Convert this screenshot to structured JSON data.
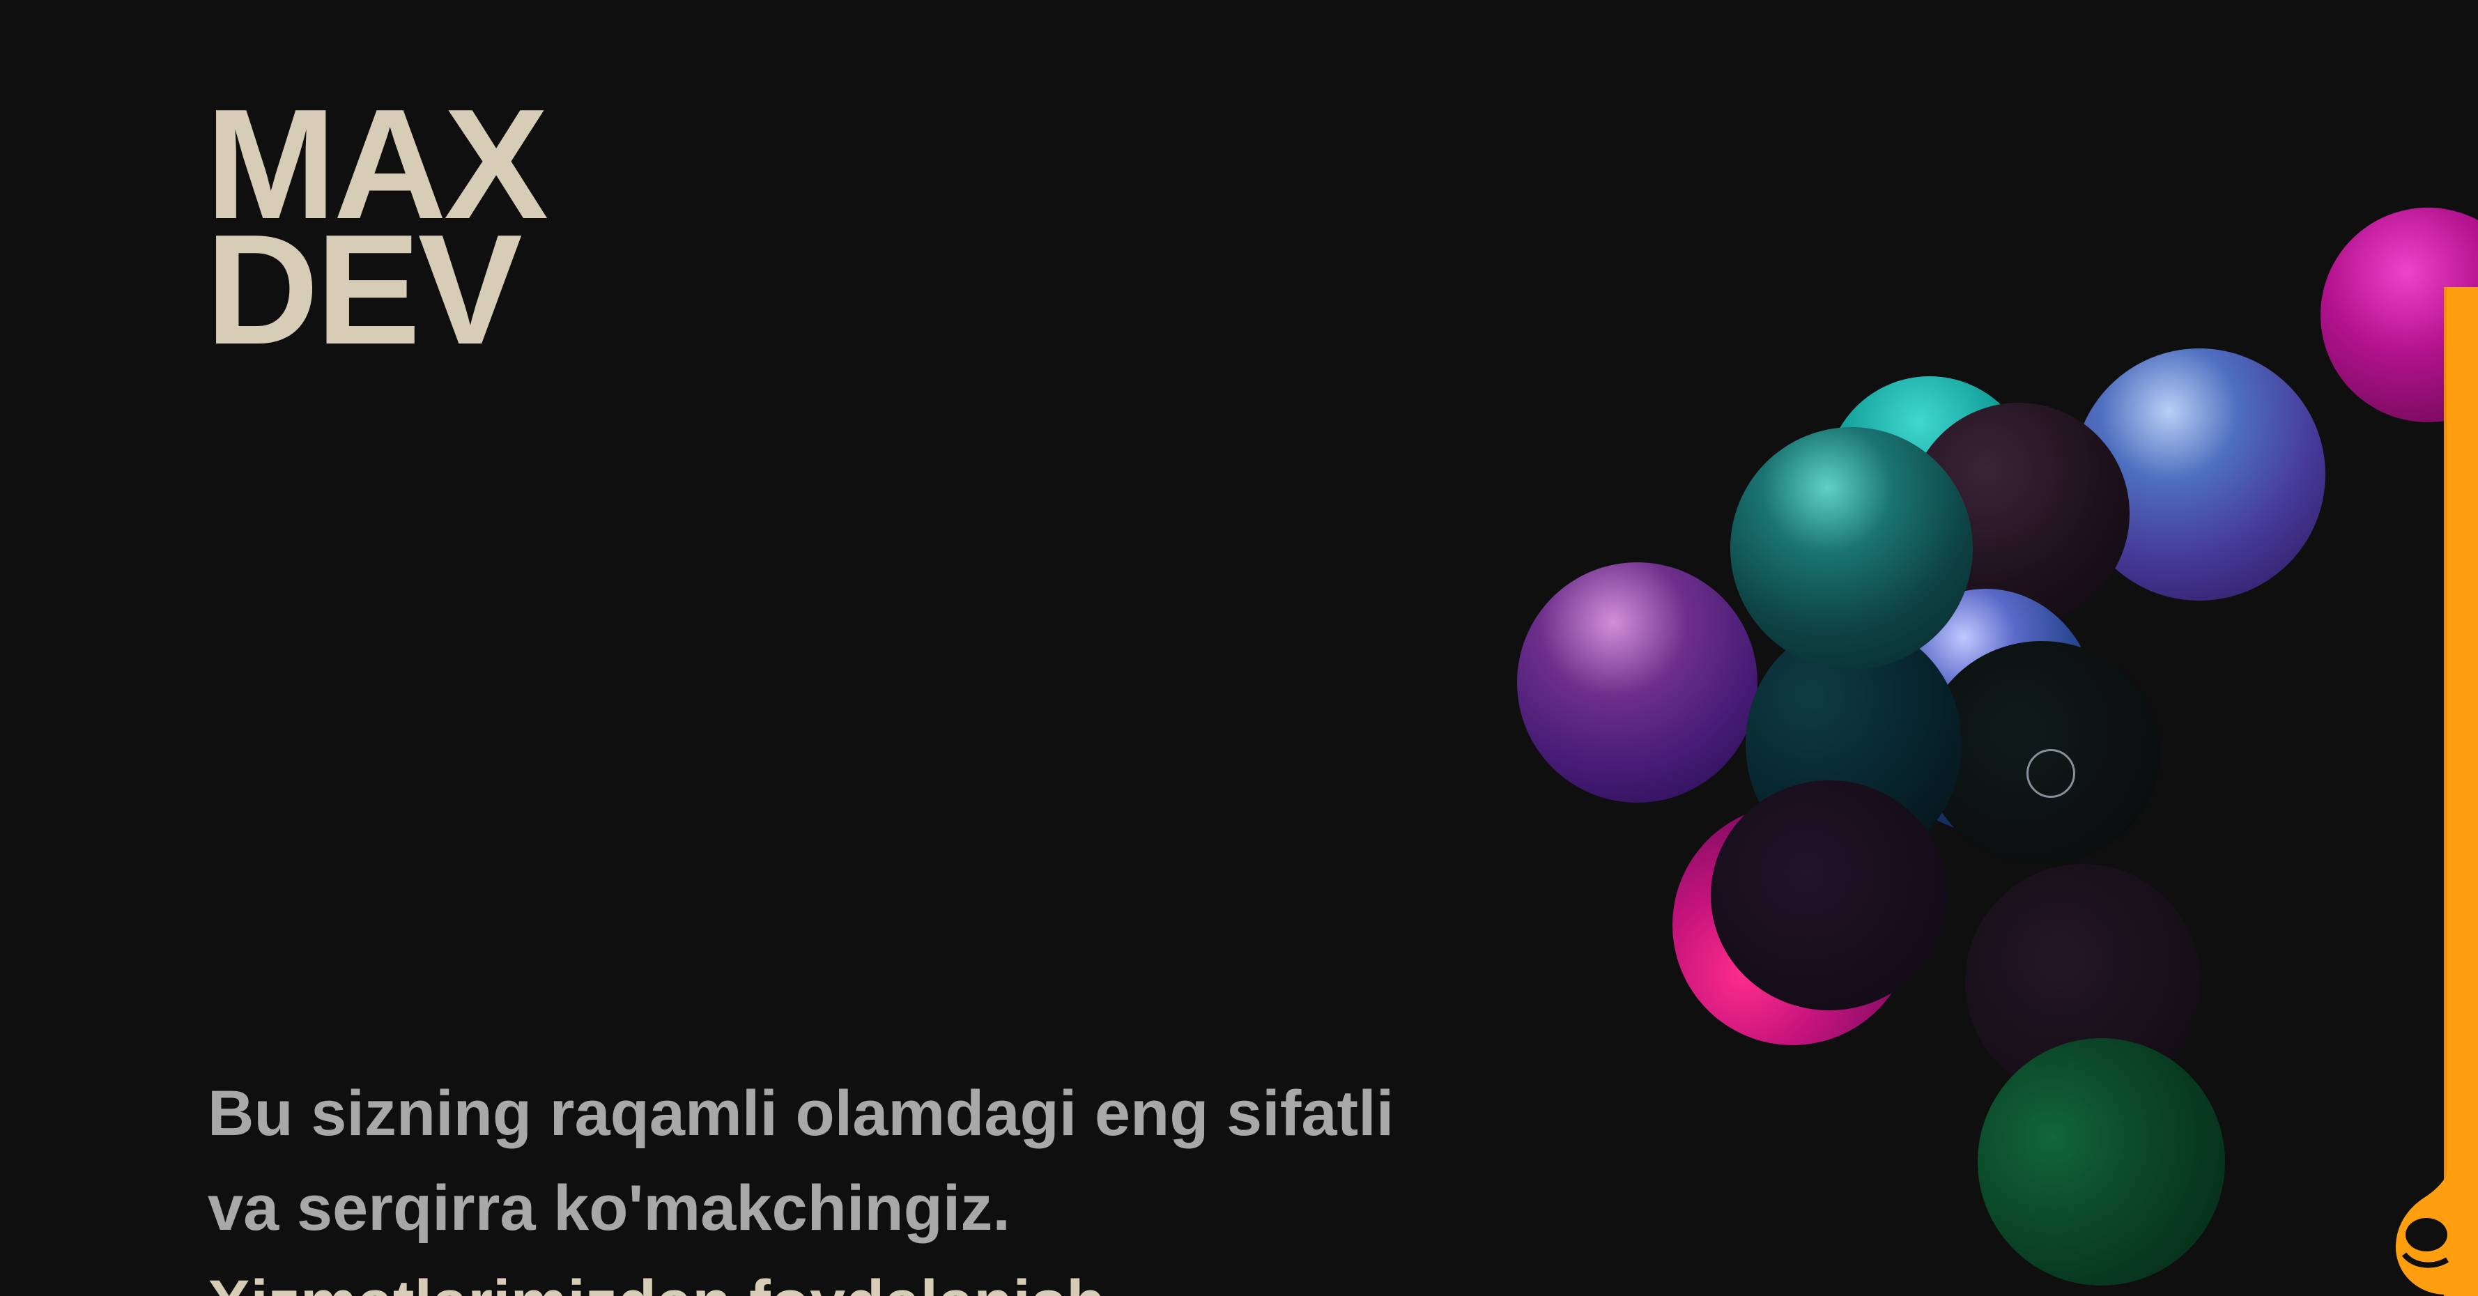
{
  "brand": {
    "line1": "MAX",
    "line2": "DEV"
  },
  "hero": {
    "tagline": [
      "Bu sizning raqamli olamdagi eng sifatli",
      "va serqirra ko'makchingiz.",
      "Xizmatlarimizdan foydalanish"
    ]
  },
  "colors": {
    "background": "#0f0f0f",
    "brand": "#d7ccb5",
    "body_text": "#a8a8a8",
    "accent": "#ff9f0f"
  },
  "decor": {
    "spheres": [
      "magenta",
      "teal",
      "blue-violet",
      "dark-plum",
      "deep-teal",
      "purple",
      "midnight-blue",
      "charcoal",
      "hot-pink",
      "dark-violet",
      "dark-green"
    ]
  }
}
